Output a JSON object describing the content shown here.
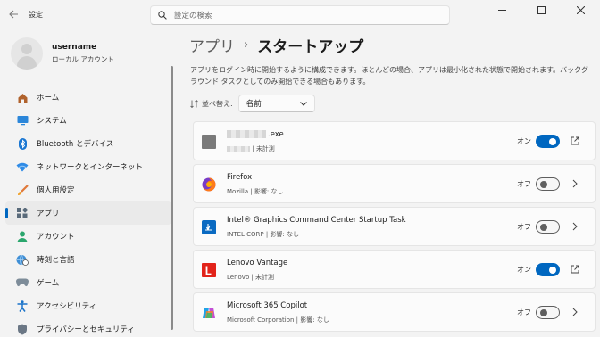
{
  "window": {
    "title": "設定"
  },
  "search": {
    "placeholder": "設定の検索"
  },
  "profile": {
    "name": "username",
    "account_type": "ローカル アカウント"
  },
  "sidebar": {
    "items": [
      {
        "label": "ホーム",
        "icon": "home-icon"
      },
      {
        "label": "システム",
        "icon": "monitor-icon"
      },
      {
        "label": "Bluetooth とデバイス",
        "icon": "bluetooth-icon"
      },
      {
        "label": "ネットワークとインターネット",
        "icon": "wifi-icon"
      },
      {
        "label": "個人用設定",
        "icon": "brush-icon"
      },
      {
        "label": "アプリ",
        "icon": "apps-icon",
        "active": true
      },
      {
        "label": "アカウント",
        "icon": "account-icon"
      },
      {
        "label": "時刻と言語",
        "icon": "globe-clock-icon"
      },
      {
        "label": "ゲーム",
        "icon": "gamepad-icon"
      },
      {
        "label": "アクセシビリティ",
        "icon": "accessibility-icon"
      },
      {
        "label": "プライバシーとセキュリティ",
        "icon": "shield-icon"
      }
    ]
  },
  "breadcrumb": {
    "parent": "アプリ",
    "separator": "›",
    "current": "スタートアップ"
  },
  "description": "アプリをログイン時に開始するように構成できます。ほとんどの場合、アプリは最小化された状態で開始されます。バックグラウンド タスクとしてのみ開始できる場合もあります。",
  "sort": {
    "label": "並べ替え:",
    "value": "名前"
  },
  "apps": [
    {
      "name": ".exe",
      "publisher": "",
      "impact": "未計測",
      "state": "オン",
      "on": true,
      "action": "open-external-icon"
    },
    {
      "name": "Firefox",
      "publisher": "Mozilla",
      "impact": "影響: なし",
      "state": "オフ",
      "on": false,
      "action": "chevron-right-icon"
    },
    {
      "name": "Intel® Graphics Command Center Startup Task",
      "publisher": "INTEL CORP",
      "impact": "影響: なし",
      "state": "オフ",
      "on": false,
      "action": "chevron-right-icon"
    },
    {
      "name": "Lenovo Vantage",
      "publisher": "Lenovo",
      "impact": "未計測",
      "state": "オン",
      "on": true,
      "action": "open-external-icon"
    },
    {
      "name": "Microsoft 365 Copilot",
      "publisher": "Microsoft Corporation",
      "impact": "影響: なし",
      "state": "オフ",
      "on": false,
      "action": "chevron-right-icon"
    }
  ],
  "colors": {
    "accent": "#0067c0",
    "background": "#f3f3f3",
    "card": "#fbfbfb"
  }
}
